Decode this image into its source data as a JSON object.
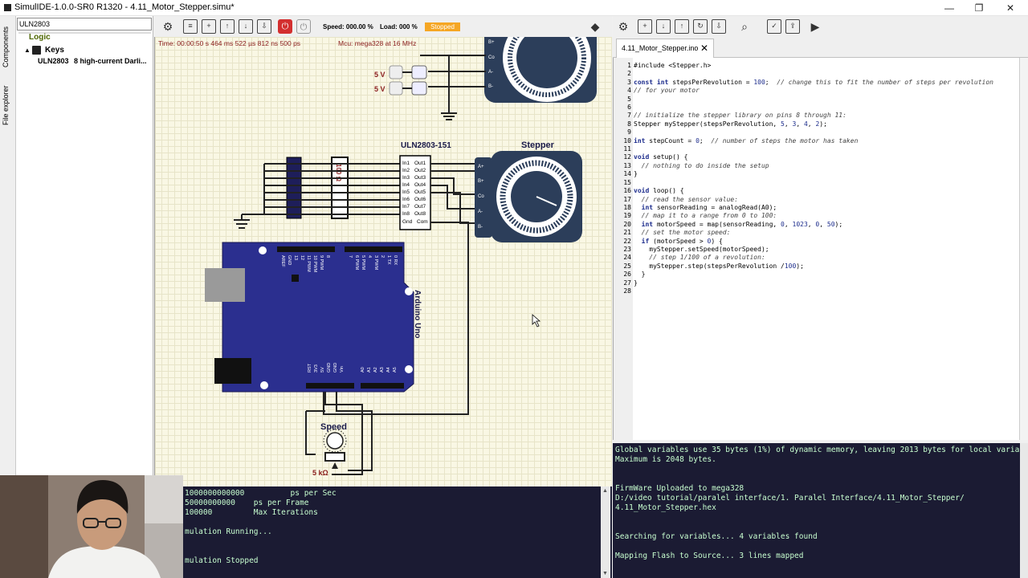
{
  "window": {
    "title": "SimulIDE-1.0.0-SR0 R1320 - 4.11_Motor_Stepper.simu*",
    "minimize": "—",
    "maximize": "❐",
    "close": "✕"
  },
  "left_dock": {
    "tabs": [
      "Components",
      "File explorer"
    ],
    "search_value": "ULN2803",
    "tree": {
      "category": "Logic",
      "group": "Keys",
      "item_name": "ULN2803",
      "item_desc": "8 high-current Darli..."
    }
  },
  "sim_toolbar": {
    "speed": "Speed: 000.00 %",
    "load": "Load: 000 %",
    "status": "Stopped"
  },
  "canvas": {
    "time_readout": "Time: 00:00:50 s   464 ms   522 µs   812 ns   500 ps",
    "mcu_readout": "Mcu: mega328 at 16 MHz",
    "labels": {
      "uln": "ULN2803-151",
      "stepper": "Stepper",
      "arduino": "Arduino Uno",
      "speed": "Speed",
      "pot_value": "5 kΩ",
      "resistor": "100 Ω",
      "v1": "5 V",
      "v2": "5 V"
    },
    "uln_inputs": [
      "In1",
      "In2",
      "In3",
      "In4",
      "In5",
      "In6",
      "In7",
      "In8",
      "Gnd"
    ],
    "uln_outputs": [
      "Out1",
      "Out2",
      "Out3",
      "Out4",
      "Out5",
      "Out6",
      "Out7",
      "Out8",
      "Com"
    ],
    "stepper_pins": [
      "A+",
      "B+",
      "Co",
      "A-",
      "B-"
    ],
    "arduino_top_pins": [
      "AREF",
      "GND",
      "13",
      "12",
      "11 PWM",
      "10 PWM",
      "9 PWM",
      "8",
      "7",
      "6 PWM",
      "5 PWM",
      "4",
      "3 PWM",
      "2",
      "1 TX",
      "0 RX"
    ],
    "arduino_bottom_pins": [
      "RST",
      "3V3",
      "5V",
      "GND",
      "GND",
      "Vin",
      "A0",
      "A1",
      "A2",
      "A3",
      "A4",
      "A5"
    ]
  },
  "editor": {
    "tab_label": "4.11_Motor_Stepper.ino",
    "line_numbers": [
      "1",
      "2",
      "3",
      "4",
      "5",
      "6",
      "7",
      "8",
      "9",
      "10",
      "11",
      "12",
      "13",
      "14",
      "15",
      "16",
      "17",
      "18",
      "19",
      "20",
      "21",
      "22",
      "23",
      "24",
      "25",
      "26",
      "27",
      "28"
    ],
    "lines": [
      "#include <Stepper.h>",
      "",
      "const int stepsPerRevolution = 100;  // change this to fit the number of steps per revolution",
      "// for your motor",
      "",
      "",
      "// initialize the stepper library on pins 8 through 11:",
      "Stepper myStepper(stepsPerRevolution, 5, 3, 4, 2);",
      "",
      "int stepCount = 0;  // number of steps the motor has taken",
      "",
      "void setup() {",
      "  // nothing to do inside the setup",
      "}",
      "",
      "void loop() {",
      "  // read the sensor value:",
      "  int sensorReading = analogRead(A0);",
      "  // map it to a range from 0 to 100:",
      "  int motorSpeed = map(sensorReading, 0, 1023, 0, 50);",
      "  // set the motor speed:",
      "  if (motorSpeed > 0) {",
      "    myStepper.setSpeed(motorSpeed);",
      "    // step 1/100 of a revolution:",
      "    myStepper.step(stepsPerRevolution /100);",
      "  }",
      "}",
      ""
    ]
  },
  "console_left": {
    "lines": [
      "1000000000000          ps per Sec",
      "50000000000    ps per Frame",
      "100000         Max Iterations",
      "",
      "mulation Running...",
      "",
      "",
      "mulation Stopped"
    ]
  },
  "console_right": {
    "lines": [
      "Global variables use 35 bytes (1%) of dynamic memory, leaving 2013 bytes for local variables.",
      "Maximum is 2048 bytes.",
      "",
      "",
      "FirmWare Uploaded to mega328",
      "D:/video tutorial/paralel interface/1. Paralel Interface/4.11_Motor_Stepper/",
      "4.11_Motor_Stepper.hex",
      "",
      "",
      "Searching for variables... 4 variables found",
      "",
      "Mapping Flash to Source... 3 lines mapped"
    ]
  },
  "colors": {
    "console_bg": "#1b1b33",
    "console_text": "#c8ffd0",
    "arduino_board": "#2b2f8f",
    "motor_body": "#2c3e5a",
    "status_badge": "#f5a623",
    "canvas_bg": "#f9f7e4"
  }
}
